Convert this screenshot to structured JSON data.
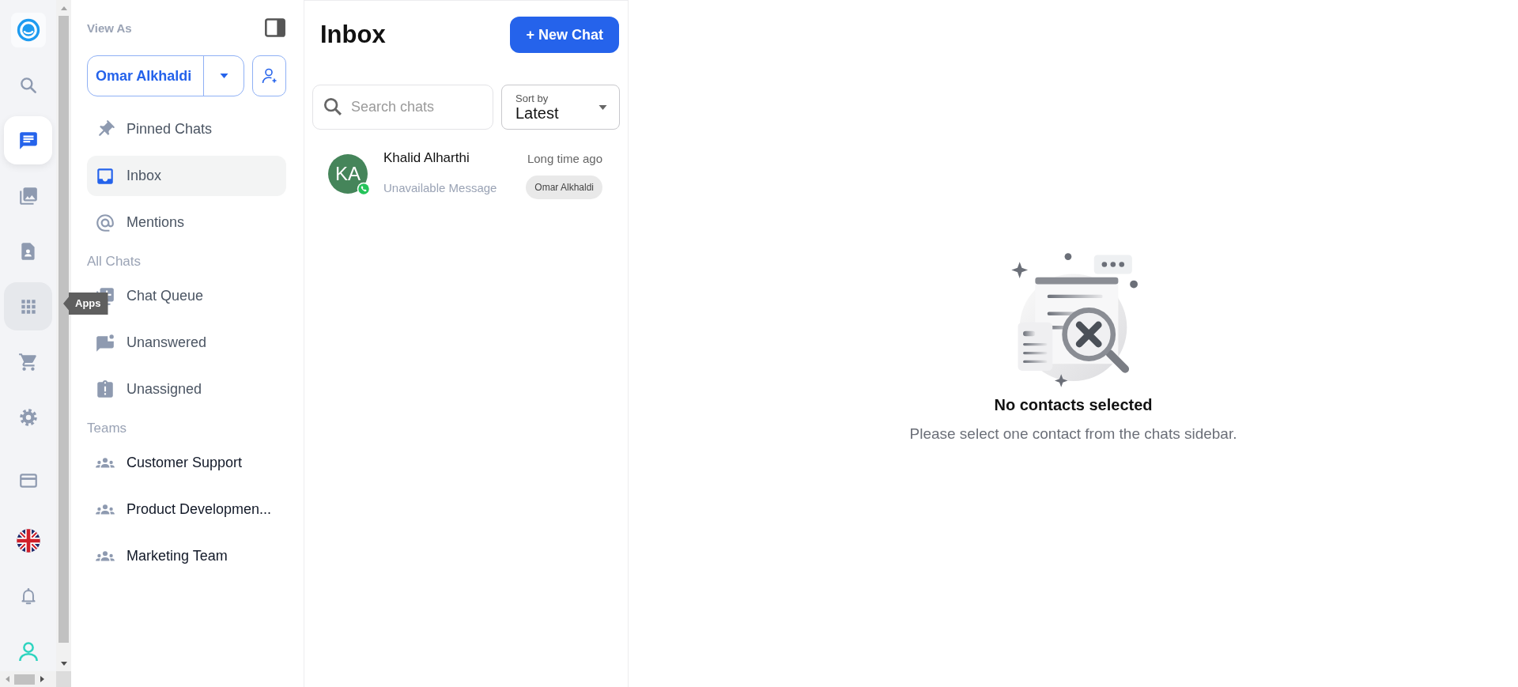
{
  "rail": {
    "items": [
      {
        "kind": "logo",
        "selected": false,
        "hovered": false
      },
      {
        "kind": "search",
        "selected": false,
        "hovered": false
      },
      {
        "kind": "chat",
        "selected": true,
        "hovered": false
      },
      {
        "kind": "photos",
        "selected": false,
        "hovered": false
      },
      {
        "kind": "contact",
        "selected": false,
        "hovered": false
      },
      {
        "kind": "apps",
        "selected": false,
        "hovered": true
      },
      {
        "kind": "cart",
        "selected": false,
        "hovered": false
      },
      {
        "kind": "settings",
        "selected": false,
        "hovered": false
      },
      {
        "kind": "card",
        "selected": false,
        "hovered": false
      },
      {
        "kind": "flag",
        "selected": false,
        "hovered": false
      },
      {
        "kind": "bell",
        "selected": false,
        "hovered": false
      },
      {
        "kind": "user",
        "selected": false,
        "hovered": false
      }
    ],
    "tooltip": "Apps"
  },
  "sidebar": {
    "view_as_label": "View As",
    "viewer": "Omar Alkhaldi",
    "items": [
      {
        "label": "Pinned Chats",
        "kind": "pin",
        "selected": false
      },
      {
        "label": "Inbox",
        "kind": "inbox",
        "selected": true
      },
      {
        "label": "Mentions",
        "kind": "at",
        "selected": false
      }
    ],
    "sections": [
      {
        "title": "All Chats",
        "items": [
          {
            "label": "Chat Queue",
            "kind": "queue",
            "selected": false
          },
          {
            "label": "Unanswered",
            "kind": "unanswered",
            "selected": false
          },
          {
            "label": "Unassigned",
            "kind": "unassigned",
            "selected": false
          }
        ]
      },
      {
        "title": "Teams",
        "items": [
          {
            "label": "Customer Support",
            "kind": "team",
            "selected": false
          },
          {
            "label": "Product Developmen...",
            "kind": "team",
            "selected": false
          },
          {
            "label": "Marketing Team",
            "kind": "team",
            "selected": false
          }
        ]
      }
    ]
  },
  "chat_list": {
    "title": "Inbox",
    "new_chat_button": "+ New Chat",
    "search": {
      "placeholder": "Search chats"
    },
    "sort": {
      "label": "Sort by",
      "value": "Latest"
    },
    "chats": [
      {
        "initials": "KA",
        "color": "#45855a",
        "name": "Khalid Alharthi",
        "time": "Long time ago",
        "preview": "Unavailable Message",
        "assignee": "Omar Alkhaldi"
      }
    ]
  },
  "empty_state": {
    "title": "No contacts selected",
    "message": "Please select one contact from the chats sidebar."
  }
}
